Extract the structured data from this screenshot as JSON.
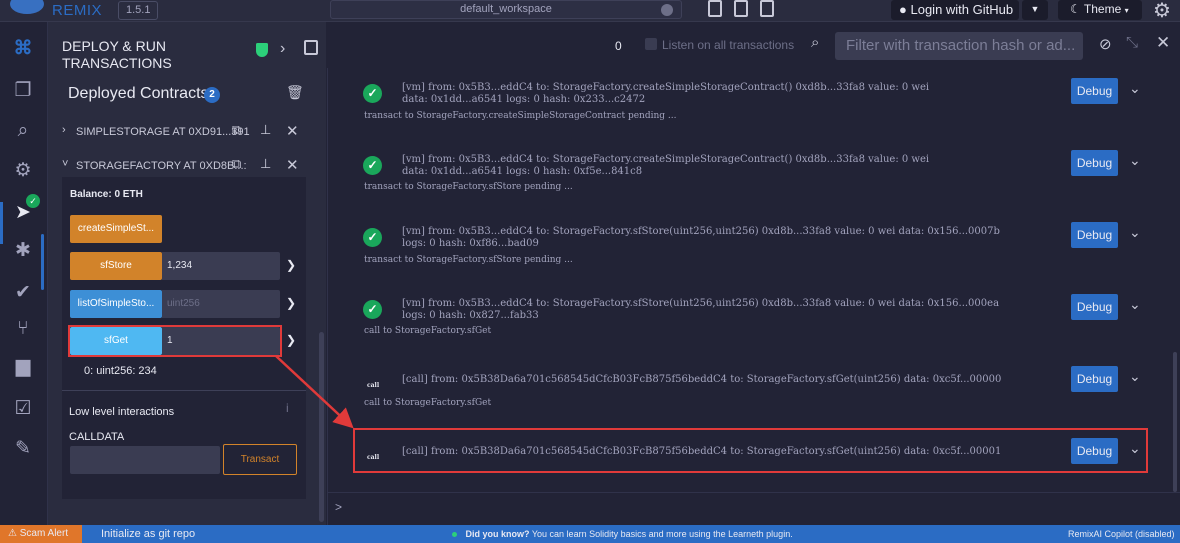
{
  "topbar": {
    "app_name": "REMIX",
    "version": "1.5.1",
    "workspace": "default_workspace",
    "login_label": "Login with GitHub",
    "theme_label": "Theme"
  },
  "side_panel": {
    "title": "DEPLOY & RUN TRANSACTIONS",
    "deployed_title": "Deployed Contracts",
    "deployed_count": "2",
    "contracts": [
      {
        "name": "SIMPLESTORAGE AT 0XD91...391"
      },
      {
        "name": "STORAGEFACTORY AT 0XD8B...:"
      }
    ],
    "balance": "Balance: 0 ETH",
    "functions": [
      {
        "label": "createSimpleSt...",
        "value": "",
        "placeholder": ""
      },
      {
        "label": "sfStore",
        "value": "1,234",
        "placeholder": ""
      },
      {
        "label": "listOfSimpleSto...",
        "value": "",
        "placeholder": "uint256"
      },
      {
        "label": "sfGet",
        "value": "1",
        "placeholder": ""
      }
    ],
    "result": "0: uint256: 234",
    "low_level_title": "Low level interactions",
    "calldata_label": "CALLDATA",
    "transact_label": "Transact"
  },
  "terminal": {
    "count": "0",
    "listen_label": "Listen on all transactions",
    "filter_placeholder": "Filter with transaction hash or ad...",
    "debug_label": "Debug",
    "prompt": ">",
    "logs": [
      {
        "status": "ok",
        "line1": "[vm] from: 0x5B3...eddC4 to: StorageFactory.createSimpleStorageContract() 0xd8b...33fa8 value: 0 wei",
        "line2": "data: 0x1dd...a6541 logs: 0 hash: 0x233...c2472",
        "follow": "transact to StorageFactory.createSimpleStorageContract pending ..."
      },
      {
        "status": "ok",
        "line1": "[vm] from: 0x5B3...eddC4 to: StorageFactory.createSimpleStorageContract() 0xd8b...33fa8 value: 0 wei",
        "line2": "data: 0x1dd...a6541 logs: 0 hash: 0xf5e...841c8",
        "follow": "transact to StorageFactory.sfStore pending ..."
      },
      {
        "status": "ok",
        "line1": "[vm] from: 0x5B3...eddC4 to: StorageFactory.sfStore(uint256,uint256) 0xd8b...33fa8 value: 0 wei data: 0x156...0007b",
        "line2": "logs: 0 hash: 0xf86...bad09",
        "follow": "transact to StorageFactory.sfStore pending ..."
      },
      {
        "status": "ok",
        "line1": "[vm] from: 0x5B3...eddC4 to: StorageFactory.sfStore(uint256,uint256) 0xd8b...33fa8 value: 0 wei data: 0x156...000ea",
        "line2": "logs: 0 hash: 0x827...fab33",
        "follow": "call to StorageFactory.sfGet"
      },
      {
        "status": "call",
        "line1": "[call] from: 0x5B38Da6a701c568545dCfcB03FcB875f56beddC4 to: StorageFactory.sfGet(uint256) data: 0xc5f...00000",
        "line2": "",
        "follow": "call to StorageFactory.sfGet"
      },
      {
        "status": "call",
        "line1": "[call] from: 0x5B38Da6a701c568545dCfcB03FcB875f56beddC4 to: StorageFactory.sfGet(uint256) data: 0xc5f...00001",
        "line2": "",
        "follow": ""
      }
    ],
    "call_tag": "call"
  },
  "statusbar": {
    "scam_alert": "Scam Alert",
    "git_init": "Initialize as git repo",
    "tip_bold": "Did you know?",
    "tip_text": "You can learn Solidity basics and more using the Learneth plugin.",
    "copilot": "RemixAI Copilot (disabled)"
  },
  "colors": {
    "accent": "#2b6cc4",
    "transact_button": "#d2832a",
    "call_button": "#3d8fd6",
    "highlight": "#e03a3a",
    "success": "#1aa75b"
  }
}
